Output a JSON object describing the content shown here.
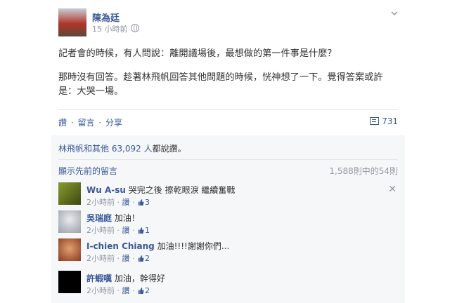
{
  "post": {
    "author": "陳為廷",
    "time": "15 小時前",
    "paragraphs": [
      "記者會的時候，有人問說：離開議場後，最想做的第一件事是什麼？",
      "那時沒有回答。趁著林飛帆回答其他問題的時候，恍神想了一下。覺得答案或許是：大哭一場。"
    ]
  },
  "actions": {
    "like": "讚",
    "comment": "留言",
    "share": "分享",
    "sep": "·",
    "comment_count": "731"
  },
  "likes": {
    "names": "林飛帆和其他 63,092 人",
    "suffix": "都說讚。"
  },
  "comments_header": {
    "show_previous": "顯示先前的留言",
    "pager": "1,588則中的54則"
  },
  "comments": [
    {
      "name": "Wu A-su",
      "text": "哭完之後 擦乾眼淚 繼續奮戰",
      "time": "2小時前",
      "like": "讚",
      "likes": "3",
      "avatar_color": "#6b7a2a"
    },
    {
      "name": "吳瑞庭",
      "text": "加油！",
      "time": "2小時前",
      "like": "讚",
      "likes": "1",
      "avatar_color": "#b8bcc2"
    },
    {
      "name": "I-chien Chiang",
      "text": "加油!!!!謝謝你們...",
      "time": "2小時前",
      "like": "讚",
      "likes": "2",
      "avatar_color": "#c27a4a"
    },
    {
      "name": "許蝦嘆",
      "text": "加油，幹得好",
      "time": "2小時前",
      "like": "讚",
      "likes": "2",
      "avatar_color": "#000000"
    }
  ]
}
